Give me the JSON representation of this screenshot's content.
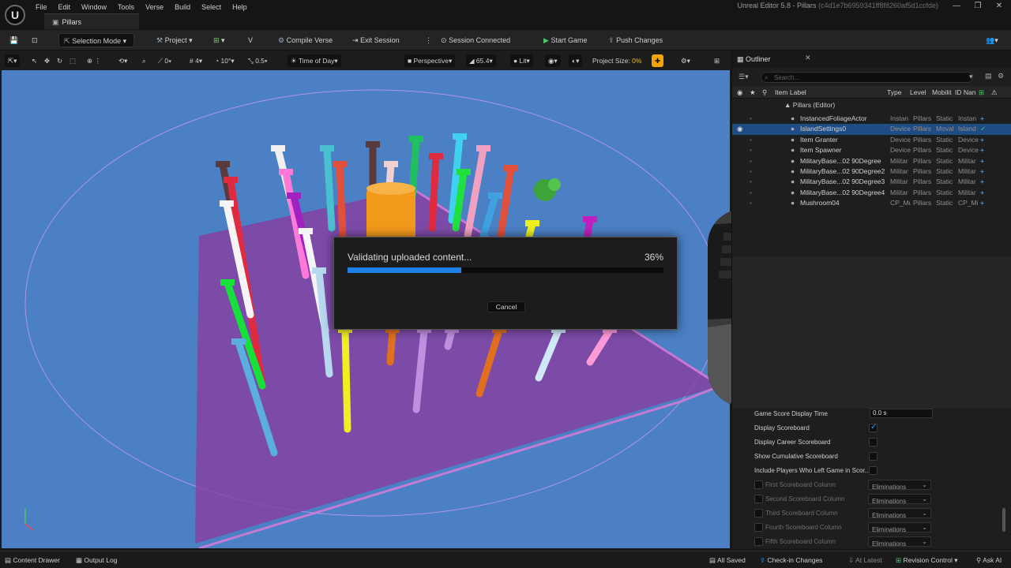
{
  "menu": [
    "File",
    "Edit",
    "Window",
    "Tools",
    "Verse",
    "Build",
    "Select",
    "Help"
  ],
  "window_title": "Unreal Editor 5.8 - Pillars",
  "window_id": "(c4d1e7b6959341ff8f8260af5d1ccfde)",
  "tab_label": "Pillars",
  "toolbar": {
    "selection_mode": "Selection Mode",
    "project": "Project",
    "compile_verse": "Compile Verse",
    "exit_session": "Exit Session",
    "session_connected": "Session Connected",
    "start_game": "Start Game",
    "push_changes": "Push Changes"
  },
  "viewport_toolbar": {
    "rotate_snap": "0",
    "grid_snap": "4",
    "angle_snap": "10°",
    "scale_snap": "0.5",
    "time_of_day": "Time of Day",
    "perspective": "Perspective",
    "fov": "65.4",
    "lit": "Lit",
    "project_size_label": "Project Size:",
    "project_size_value": "0%"
  },
  "dialog": {
    "message": "Validating uploaded content...",
    "percent_label": "36%",
    "progress": 0.36,
    "cancel_label": "Cancel"
  },
  "outliner": {
    "title": "Outliner",
    "search_placeholder": "Search...",
    "columns": [
      "Item Label",
      "Type",
      "Level",
      "Mobilit",
      "ID Nan"
    ],
    "group": "Pillars (Editor)",
    "rows": [
      {
        "label": "InstancedFoliageActor",
        "type": "Instan",
        "level": "Pillars",
        "mob": "Static",
        "id": "Instan",
        "sel": false
      },
      {
        "label": "IslandSettings0",
        "type": "Device",
        "level": "Pillars",
        "mob": "Moval",
        "id": "Island",
        "sel": true
      },
      {
        "label": "Item Granter",
        "type": "Device",
        "level": "Pillars",
        "mob": "Static",
        "id": "Device",
        "sel": false
      },
      {
        "label": "Item Spawner",
        "type": "Device",
        "level": "Pillars",
        "mob": "Static",
        "id": "Device",
        "sel": false
      },
      {
        "label": "MilitaryBase...02 90Degree",
        "type": "Militar",
        "level": "Pillars",
        "mob": "Static",
        "id": "Militar",
        "sel": false
      },
      {
        "label": "MilitaryBase...02 90Degree2",
        "type": "Militar",
        "level": "Pillars",
        "mob": "Static",
        "id": "Militar",
        "sel": false
      },
      {
        "label": "MilitaryBase...02 90Degree3",
        "type": "Militar",
        "level": "Pillars",
        "mob": "Static",
        "id": "Militar",
        "sel": false
      },
      {
        "label": "MilitaryBase...02 90Degree4",
        "type": "Militar",
        "level": "Pillars",
        "mob": "Static",
        "id": "Militar",
        "sel": false
      },
      {
        "label": "Mushroom04",
        "type": "CP_Mu",
        "level": "Pillars",
        "mob": "Static",
        "id": "CP_Mi",
        "sel": false
      }
    ]
  },
  "details": {
    "game_score_display_time_label": "Game Score Display Time",
    "game_score_display_time_value": "0.0 s",
    "checkboxes": [
      {
        "label": "Display Scoreboard",
        "checked": true
      },
      {
        "label": "Display Career Scoreboard",
        "checked": false
      },
      {
        "label": "Show Cumulative Scoreboard",
        "checked": false
      },
      {
        "label": "Include Players Who Left Game in Scor...",
        "checked": false
      }
    ],
    "columns": [
      {
        "label": "First Scoreboard Column",
        "value": "Eliminations"
      },
      {
        "label": "Second Scoreboard Column",
        "value": "Eliminations"
      },
      {
        "label": "Third Scoreboard Column",
        "value": "Eliminations"
      },
      {
        "label": "Fourth Scoreboard Column",
        "value": "Eliminations"
      },
      {
        "label": "Fifth Scoreboard Column",
        "value": "Eliminations"
      }
    ]
  },
  "statusbar": {
    "content_drawer": "Content Drawer",
    "output_log": "Output Log",
    "all_saved": "All Saved",
    "check_in": "Check-in Changes",
    "at_latest": "At Latest",
    "revision_control": "Revision Control",
    "ask_ai": "Ask AI"
  }
}
